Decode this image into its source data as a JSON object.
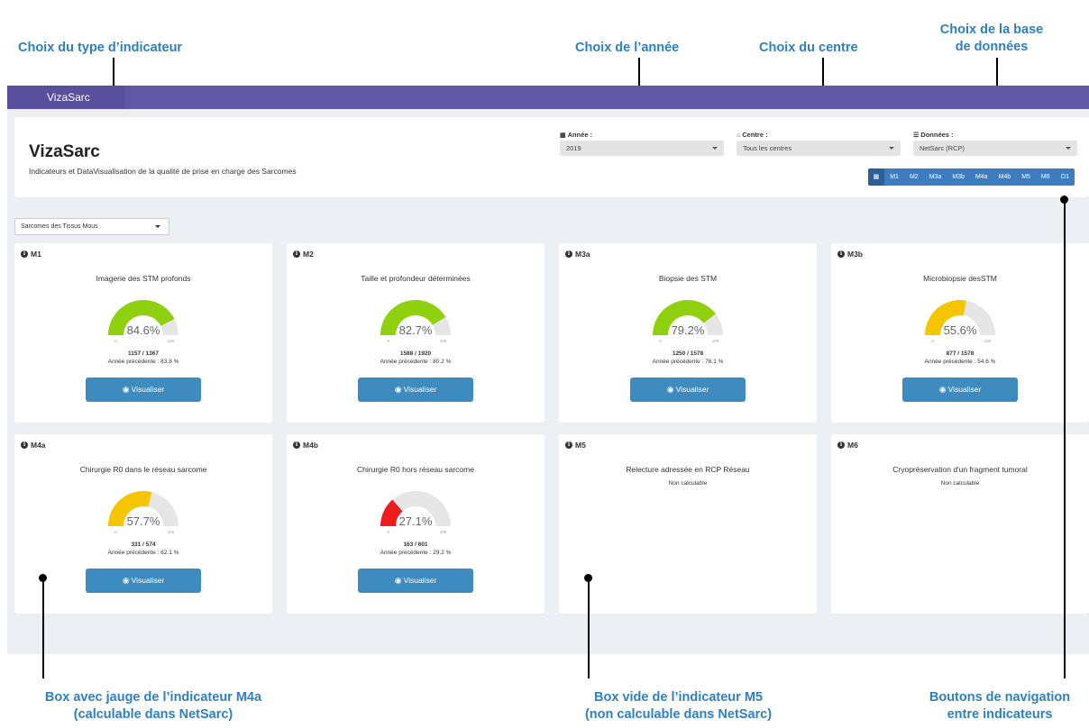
{
  "annotations": {
    "type_indicateur": "Choix du type d’indicateur",
    "annee": "Choix de l’année",
    "centre": "Choix du centre",
    "base_line1": "Choix de la base",
    "base_line2": "de données",
    "box_m4a_line1": "Box avec jauge de l’indicateur M4a",
    "box_m4a_line2": "(calculable dans NetSarc)",
    "box_m5_line1": "Box vide de l’indicateur M5",
    "box_m5_line2": "(non calculable dans NetSarc)",
    "nav_line1": "Boutons de navigation",
    "nav_line2": "entre indicateurs"
  },
  "navbar": {
    "brand": "VizaSarc"
  },
  "header": {
    "title": "VizaSarc",
    "subtitle": "Indicateurs et DataVisualisation de la qualité de prise en charge des Sarcomes"
  },
  "filters": {
    "annee": {
      "label": "Année :",
      "value": "2019",
      "icon": "calendar-icon"
    },
    "centre": {
      "label": "Centre :",
      "value": "Tous les centres",
      "icon": "home-icon"
    },
    "donnees": {
      "label": "Données :",
      "value": "NetSarc (RCP)",
      "icon": "database-icon"
    }
  },
  "nav_buttons": [
    "M1",
    "M2",
    "M3a",
    "M3b",
    "M4a",
    "M4b",
    "M5",
    "M6",
    "O1"
  ],
  "type_select": {
    "value": "Sarcomes des Tissus Mous"
  },
  "visualiser_label": "Visualiser",
  "gauge_min": "0",
  "gauge_max": "100",
  "colors": {
    "green": "#8fd10e",
    "yellow": "#f7c500",
    "red": "#ef1c1c",
    "track": "#e6e6e6",
    "button": "#3d8bbf",
    "navbar": "#6057a6"
  },
  "cards": [
    {
      "id": "M1",
      "title": "Imagerie des STM profonds",
      "percent": 84.6,
      "percent_label": "84.6%",
      "count": "1157 / 1367",
      "prev": "Année précédente : 83.8 %",
      "color": "#8fd10e"
    },
    {
      "id": "M2",
      "title": "Taille et profondeur déterminées",
      "percent": 82.7,
      "percent_label": "82.7%",
      "count": "1588 / 1920",
      "prev": "Année précédente : 80.2 %",
      "color": "#8fd10e"
    },
    {
      "id": "M3a",
      "title": "Biopsie des STM",
      "percent": 79.2,
      "percent_label": "79.2%",
      "count": "1250 / 1578",
      "prev": "Année précédente : 76.1 %",
      "color": "#8fd10e"
    },
    {
      "id": "M3b",
      "title": "Microbiopsie desSTM",
      "percent": 55.6,
      "percent_label": "55.6%",
      "count": "877 / 1578",
      "prev": "Année précédente : 54.6 %",
      "color": "#f7c500"
    },
    {
      "id": "M4a",
      "title": "Chirurgie R0 dans le réseau sarcome",
      "percent": 57.7,
      "percent_label": "57.7%",
      "count": "331 / 574",
      "prev": "Année précédente : 62.1 %",
      "color": "#f7c500"
    },
    {
      "id": "M4b",
      "title": "Chirurgie R0 hors réseau sarcome",
      "percent": 27.1,
      "percent_label": "27.1%",
      "count": "163 / 601",
      "prev": "Année précédente : 29.2 %",
      "color": "#ef1c1c"
    },
    {
      "id": "M5",
      "title": "Relecture adressée en RCP Réseau",
      "noncalc": "Non calculable"
    },
    {
      "id": "M6",
      "title": "Cryopréservation d'un fragment tumoral",
      "noncalc": "Non calculable"
    }
  ]
}
